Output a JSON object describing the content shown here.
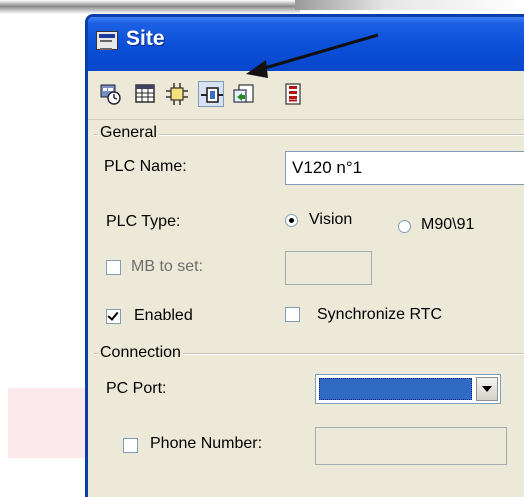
{
  "window": {
    "title": "Site"
  },
  "toolbar": {
    "buttons": [
      {
        "icon": "clock-icon"
      },
      {
        "icon": "table-icon"
      },
      {
        "icon": "network-icon"
      },
      {
        "icon": "plc-connect-icon",
        "active": true
      },
      {
        "icon": "export-icon"
      },
      {
        "icon": "ladder-icon"
      }
    ]
  },
  "general": {
    "section_label": "General",
    "plc_name_label": "PLC Name:",
    "plc_name_value": "V120 n°1",
    "plc_type_label": "PLC Type:",
    "plc_type_options": [
      {
        "label": "Vision",
        "selected": true
      },
      {
        "label": "M90\\91",
        "selected": false
      }
    ],
    "mb_to_set_label": "MB to set:",
    "mb_to_set_checked": false,
    "enabled_label": "Enabled",
    "enabled_checked": true,
    "sync_rtc_label": "Synchronize RTC",
    "sync_rtc_checked": false
  },
  "connection": {
    "section_label": "Connection",
    "pc_port_label": "PC Port:",
    "phone_number_label": "Phone Number:",
    "phone_number_checked": false
  },
  "colors": {
    "titlebar": "#0b4fd8",
    "selection": "#316ac5",
    "dialog_bg": "#ece9d8"
  }
}
